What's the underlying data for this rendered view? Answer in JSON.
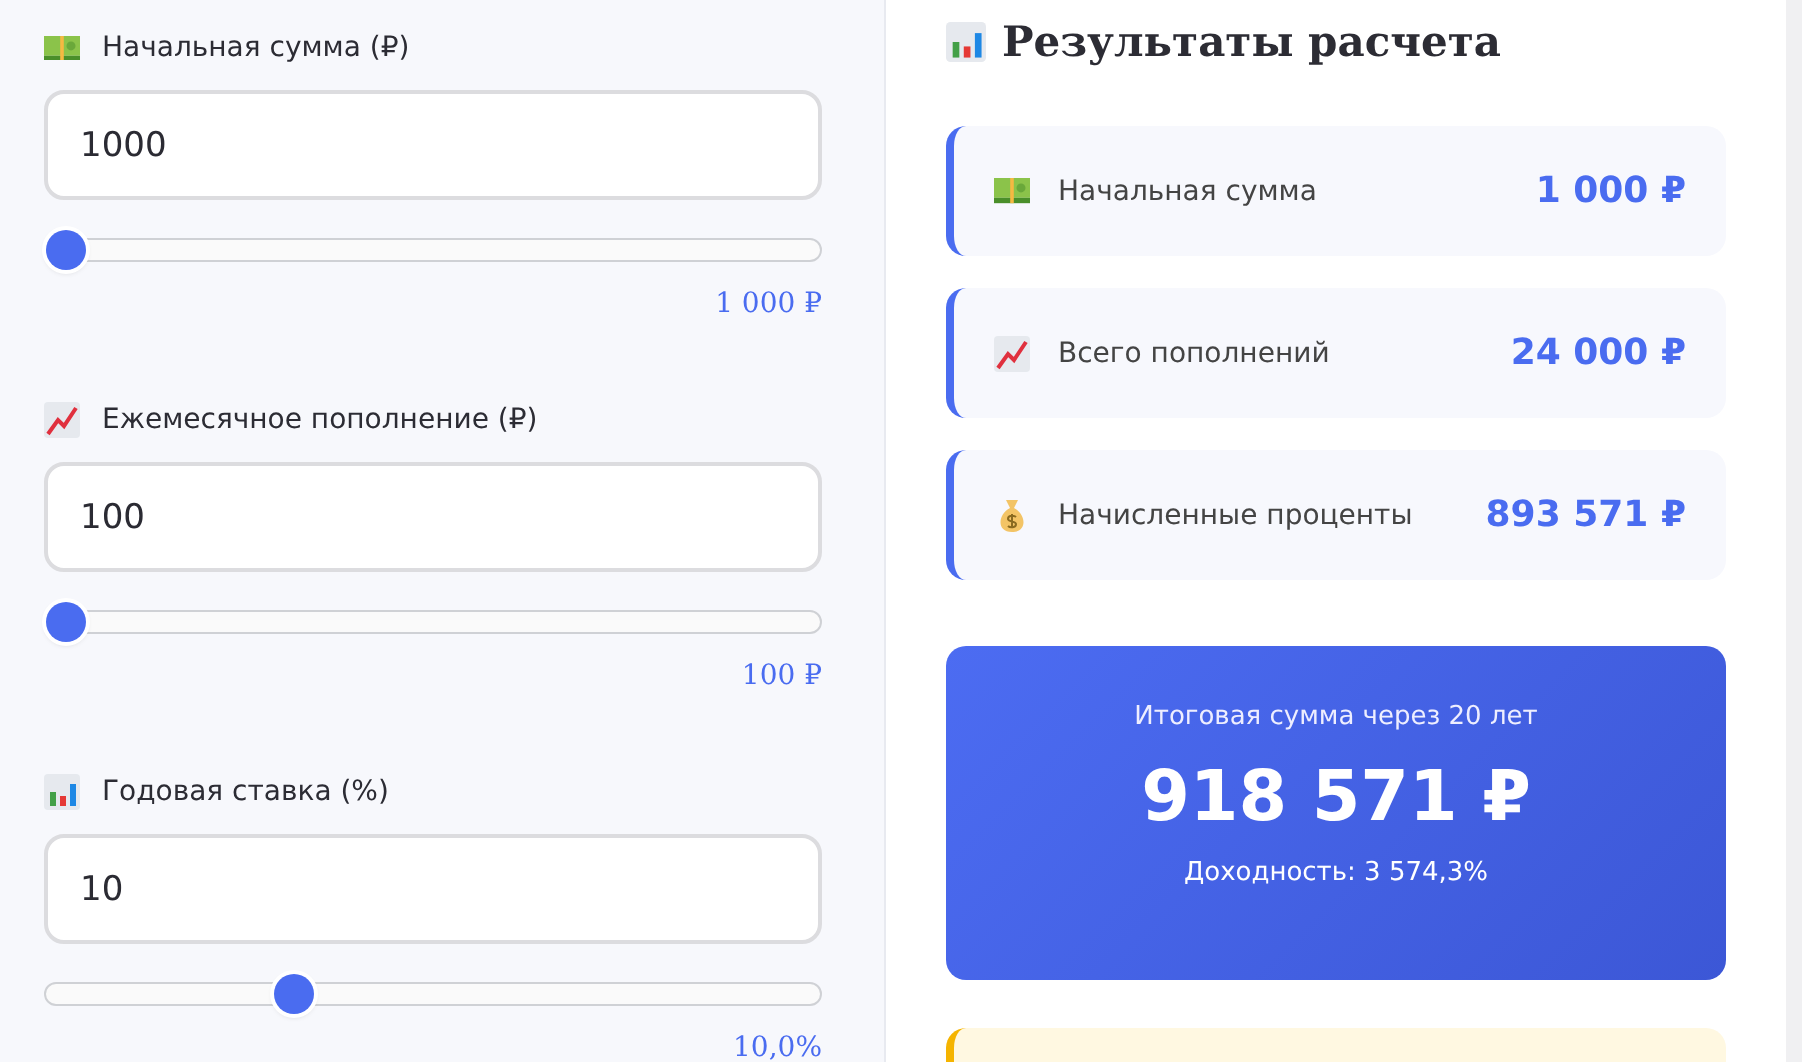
{
  "inputs": [
    {
      "kind": "money",
      "label": "Начальная сумма (₽)",
      "value": "1000",
      "level": 0.0,
      "reading": "1 000 ₽"
    },
    {
      "kind": "trend",
      "label": "Ежемесячное пополнение (₽)",
      "value": "100",
      "level": 0.0,
      "reading": "100 ₽"
    },
    {
      "kind": "chart",
      "label": "Годовая ставка (%)",
      "value": "10",
      "level": 0.31,
      "reading": "10,0%"
    }
  ],
  "results": {
    "title": "Результаты расчета",
    "kind": "chart",
    "rows": [
      {
        "kind": "money",
        "label": "Начальная сумма",
        "value": "1 000 ₽"
      },
      {
        "kind": "trend",
        "label": "Всего пополнений",
        "value": "24 000 ₽"
      },
      {
        "kind": "bag",
        "label": "Начисленные проценты",
        "value": "893 571 ₽"
      }
    ],
    "total": {
      "caption": "Итоговая сумма через 20 лет",
      "amount": "918 571 ₽",
      "yield": "Доходность: 3 574,3%"
    }
  }
}
